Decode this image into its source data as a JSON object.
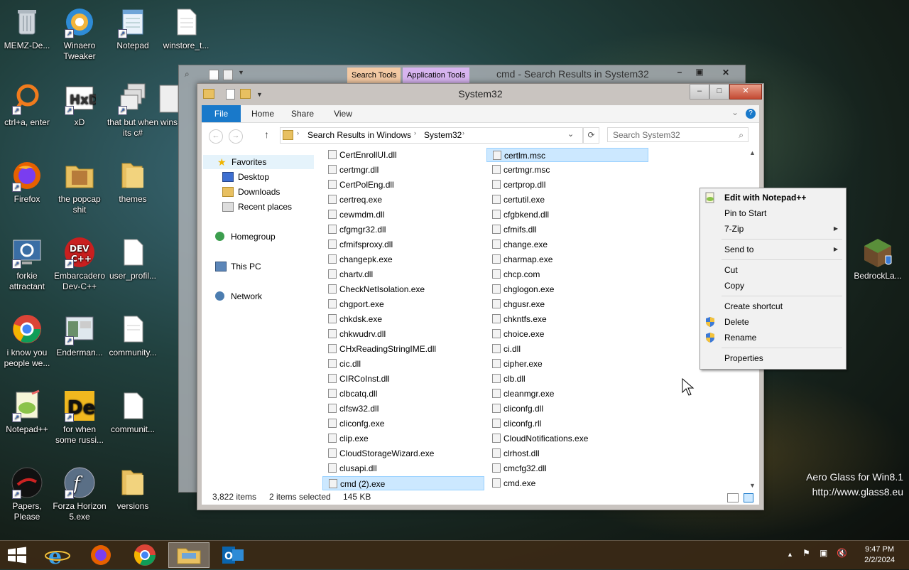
{
  "desktop": {
    "icons": [
      {
        "label": "MEMZ-De...",
        "icon": "recycle-bin-icon"
      },
      {
        "label": "Winaero Tweaker",
        "icon": "winaero-icon"
      },
      {
        "label": "Notepad",
        "icon": "notepad-icon"
      },
      {
        "label": "winstore_t...",
        "icon": "document-icon"
      },
      {
        "label": "ctrl+a, enter",
        "icon": "search-icon"
      },
      {
        "label": "xD",
        "icon": "hxd-icon"
      },
      {
        "label": "that but when its c#",
        "icon": "windows-stack-icon"
      },
      {
        "label": "wins",
        "icon": "window-icon"
      },
      {
        "label": "Firefox",
        "icon": "firefox-icon"
      },
      {
        "label": "the popcap shit",
        "icon": "folder-icon"
      },
      {
        "label": "themes",
        "icon": "folder-icon"
      },
      {
        "label": "forkie attractant",
        "icon": "settings-icon"
      },
      {
        "label": "Embarcadero Dev-C++",
        "icon": "devcpp-icon"
      },
      {
        "label": "user_profil...",
        "icon": "document-icon"
      },
      {
        "label": "i know you people we...",
        "icon": "chrome-icon"
      },
      {
        "label": "Enderman...",
        "icon": "window-icon"
      },
      {
        "label": "community...",
        "icon": "document-icon"
      },
      {
        "label": "Notepad++",
        "icon": "notepadpp-icon"
      },
      {
        "label": "for when some russi...",
        "icon": "de-icon"
      },
      {
        "label": "communit...",
        "icon": "document-icon"
      },
      {
        "label": "Papers, Please",
        "icon": "papers-please-icon"
      },
      {
        "label": "Forza Horizon 5.exe",
        "icon": "flash-icon"
      },
      {
        "label": "versions",
        "icon": "folder-icon"
      },
      {
        "label": "BedrockLa...",
        "icon": "minecraft-icon"
      }
    ]
  },
  "back_window": {
    "title": "cmd - Search Results in System32",
    "search_tools_tab": "Search Tools",
    "application_tools_tab": "Application Tools"
  },
  "window": {
    "title": "System32",
    "ribbon": {
      "file": "File",
      "home": "Home",
      "share": "Share",
      "view": "View"
    },
    "address": {
      "crumb1": "Search Results in Windows",
      "crumb2": "System32"
    },
    "search_placeholder": "Search System32",
    "nav": {
      "favorites": "Favorites",
      "desktop": "Desktop",
      "downloads": "Downloads",
      "recent": "Recent places",
      "homegroup": "Homegroup",
      "thispc": "This PC",
      "network": "Network"
    },
    "files_col1": [
      "CertEnrollUI.dll",
      "certmgr.dll",
      "CertPolEng.dll",
      "certreq.exe",
      "cewmdm.dll",
      "cfgmgr32.dll",
      "cfmifsproxy.dll",
      "changepk.exe",
      "chartv.dll",
      "CheckNetIsolation.exe",
      "chgport.exe",
      "chkdsk.exe",
      "chkwudrv.dll",
      "CHxReadingStringIME.dll",
      "cic.dll",
      "CIRCoInst.dll",
      "clbcatq.dll",
      "clfsw32.dll",
      "cliconfg.exe",
      "clip.exe",
      "CloudStorageWizard.exe",
      "clusapi.dll",
      "cmd (2).exe"
    ],
    "files_col2": [
      "certlm.msc",
      "certmgr.msc",
      "certprop.dll",
      "certutil.exe",
      "cfgbkend.dll",
      "cfmifs.dll",
      "change.exe",
      "charmap.exe",
      "chcp.com",
      "chglogon.exe",
      "chgusr.exe",
      "chkntfs.exe",
      "choice.exe",
      "ci.dll",
      "cipher.exe",
      "clb.dll",
      "cleanmgr.exe",
      "cliconfg.dll",
      "cliconfg.rll",
      "CloudNotifications.exe",
      "clrhost.dll",
      "cmcfg32.dll",
      "cmd.exe"
    ],
    "status": {
      "count": "3,822 items",
      "selected": "2 items selected",
      "size": "145 KB"
    }
  },
  "context_menu": {
    "items": [
      "Edit with Notepad++",
      "Pin to Start",
      "7-Zip",
      "Send to",
      "Cut",
      "Copy",
      "Create shortcut",
      "Delete",
      "Rename",
      "Properties"
    ]
  },
  "taskbar": {
    "clock_time": "9:47 PM",
    "clock_date": "2/2/2024"
  },
  "watermark": {
    "line1": "Aero Glass for Win8.1",
    "line2": "http://www.glass8.eu"
  }
}
